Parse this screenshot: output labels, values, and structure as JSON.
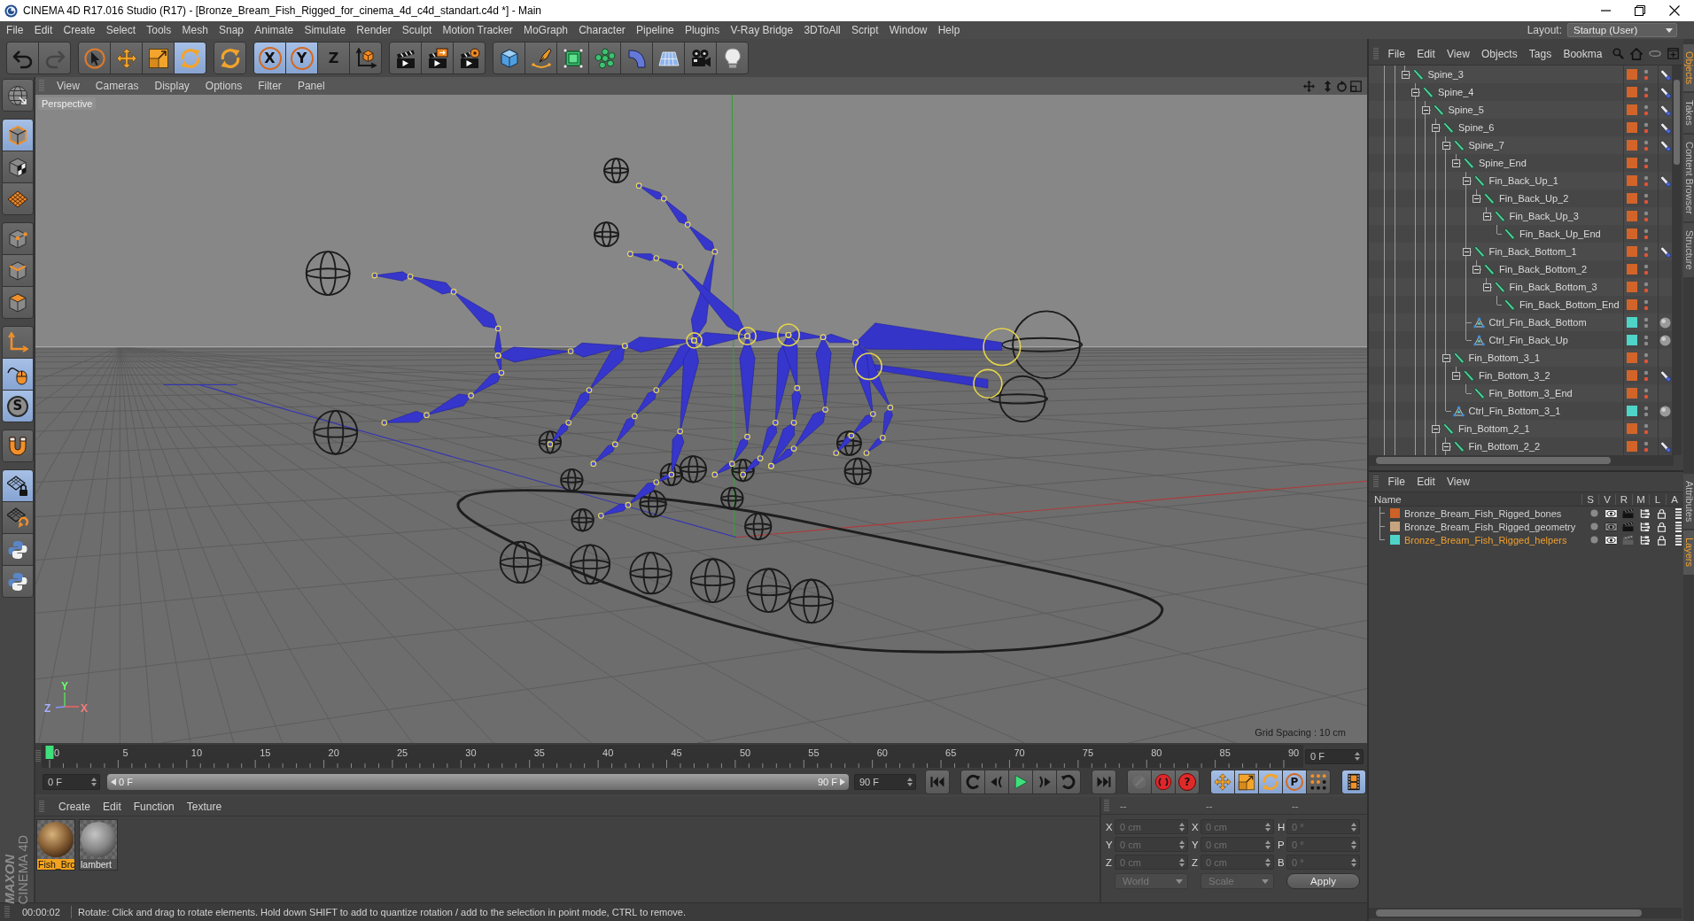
{
  "window": {
    "title": "CINEMA 4D R17.016 Studio (R17) - [Bronze_Bream_Fish_Rigged_for_cinema_4d_c4d_standart.c4d *] - Main"
  },
  "menu_bar": {
    "items": [
      "File",
      "Edit",
      "Create",
      "Select",
      "Tools",
      "Mesh",
      "Snap",
      "Animate",
      "Simulate",
      "Render",
      "Sculpt",
      "Motion Tracker",
      "MoGraph",
      "Character",
      "Pipeline",
      "Plugins",
      "V-Ray Bridge",
      "3DToAll",
      "Script",
      "Window",
      "Help"
    ],
    "layout_label": "Layout:",
    "layout": "Startup (User)"
  },
  "toolbar": {
    "groups": [
      [
        {
          "kind": "undo",
          "disabled": false
        },
        {
          "kind": "redo",
          "disabled": true
        }
      ],
      [
        {
          "kind": "live-select",
          "selected": false
        },
        {
          "kind": "move",
          "selected": false
        },
        {
          "kind": "scale",
          "selected": false
        },
        {
          "kind": "rotate",
          "selected": true
        }
      ],
      [
        {
          "kind": "recent",
          "selected": false
        }
      ],
      [
        {
          "kind": "axis",
          "label": "X",
          "selected": true
        },
        {
          "kind": "axis",
          "label": "Y",
          "selected": true
        },
        {
          "kind": "axis",
          "label": "Z",
          "selected": false
        },
        {
          "kind": "coordinates",
          "selected": false
        }
      ],
      [
        {
          "kind": "render-view"
        },
        {
          "kind": "render-picture"
        },
        {
          "kind": "render-settings"
        }
      ],
      [
        {
          "kind": "cube"
        },
        {
          "kind": "pen"
        },
        {
          "kind": "subdivision"
        },
        {
          "kind": "cloner"
        },
        {
          "kind": "bend"
        },
        {
          "kind": "floor"
        },
        {
          "kind": "camera"
        },
        {
          "kind": "light"
        }
      ]
    ]
  },
  "mode_palette": {
    "groups": [
      [
        {
          "kind": "make-editable",
          "selected": false
        }
      ],
      [
        {
          "kind": "model",
          "selected": true
        },
        {
          "kind": "texture",
          "selected": false
        },
        {
          "kind": "workplane",
          "selected": false
        }
      ],
      [
        {
          "kind": "points",
          "selected": false
        },
        {
          "kind": "edges",
          "selected": false
        },
        {
          "kind": "polygons",
          "selected": false
        }
      ],
      [
        {
          "kind": "axis-mode",
          "selected": false
        },
        {
          "kind": "tweak",
          "selected": true
        },
        {
          "kind": "solo",
          "label": "S",
          "selected": true
        }
      ],
      [
        {
          "kind": "snap",
          "selected": false
        }
      ],
      [
        {
          "kind": "lock-workplane",
          "selected": true
        },
        {
          "kind": "align-workplane",
          "selected": false
        },
        {
          "kind": "python",
          "selected": false
        },
        {
          "kind": "python",
          "selected": false
        }
      ]
    ]
  },
  "logo": {
    "brand": "MAXON",
    "product": "CINEMA 4D"
  },
  "viewport": {
    "menu": [
      "View",
      "Cameras",
      "Display",
      "Options",
      "Filter",
      "Panel"
    ],
    "camera": "Perspective",
    "grid_spacing": "Grid Spacing : 10 cm",
    "gizmo": {
      "y": "Y",
      "z": "Z",
      "x": "X"
    }
  },
  "timeline": {
    "frames": [
      "0",
      "5",
      "10",
      "15",
      "20",
      "25",
      "30",
      "35",
      "40",
      "45",
      "50",
      "55",
      "60",
      "65",
      "70",
      "75",
      "80",
      "85",
      "90"
    ],
    "playhead": {
      "level": 0
    },
    "current": "0 F"
  },
  "transport": {
    "start": "0 F",
    "range": {
      "from": "0 F",
      "to": "90 F",
      "level": 1
    },
    "end": "90 F",
    "groups": [
      [
        {
          "kind": "go-start"
        }
      ],
      [
        {
          "kind": "prev-key"
        },
        {
          "kind": "prev-frame"
        },
        {
          "kind": "play"
        },
        {
          "kind": "next-frame"
        },
        {
          "kind": "next-key"
        }
      ],
      [
        {
          "kind": "go-end"
        }
      ],
      [
        {
          "kind": "autokey",
          "disabled": true
        },
        {
          "kind": "record",
          "disabled": false
        },
        {
          "kind": "key-selection",
          "label": "?",
          "disabled": false
        }
      ],
      [
        {
          "kind": "key-position",
          "selected": true
        },
        {
          "kind": "key-scale",
          "selected": true
        },
        {
          "kind": "key-rotation",
          "selected": true
        },
        {
          "kind": "key-parameter",
          "label": "P",
          "selected": true
        },
        {
          "kind": "key-points",
          "selected": false
        }
      ],
      [
        {
          "kind": "timeline",
          "selected": true
        }
      ]
    ]
  },
  "material_manager": {
    "menu": [
      "Create",
      "Edit",
      "Function",
      "Texture"
    ],
    "items": [
      {
        "name": "Fish_Brc",
        "kind": "textured",
        "selected": true
      },
      {
        "name": "lambert",
        "kind": "plain",
        "selected": false
      }
    ]
  },
  "coordinates": {
    "headers": [
      "--",
      "--",
      "--"
    ],
    "rows": [
      [
        {
          "axis": "X",
          "value": "0 cm",
          "disabled": true
        },
        {
          "axis": "X",
          "value": "0 cm",
          "disabled": true
        },
        {
          "axis": "H",
          "value": "0 °",
          "disabled": true
        }
      ],
      [
        {
          "axis": "Y",
          "value": "0 cm",
          "disabled": true
        },
        {
          "axis": "Y",
          "value": "0 cm",
          "disabled": true
        },
        {
          "axis": "P",
          "value": "0 °",
          "disabled": true
        }
      ],
      [
        {
          "axis": "Z",
          "value": "0 cm",
          "disabled": true
        },
        {
          "axis": "Z",
          "value": "0 cm",
          "disabled": true
        },
        {
          "axis": "B",
          "value": "0 °",
          "disabled": true
        }
      ]
    ],
    "selects": [
      {
        "value": "World",
        "disabled": true
      },
      {
        "value": "Scale",
        "disabled": true
      }
    ],
    "apply": "Apply"
  },
  "status_bar": {
    "time": "00:00:02",
    "message": "Rotate: Click and drag to rotate elements. Hold down SHIFT to add to quantize rotation / add to the selection in point mode, CTRL to remove."
  },
  "object_manager": {
    "menu": [
      "File",
      "Edit",
      "View",
      "Objects",
      "Tags",
      "Bookma"
    ],
    "tree": [
      {
        "name": "Spine_3",
        "kind": "bone",
        "color": "#d2642a",
        "expanded": true,
        "tags": [
          {
            "kind": "ik"
          }
        ],
        "children": [
          {
            "name": "Spine_4",
            "kind": "bone",
            "color": "#d2642a",
            "expanded": true,
            "tags": [
              {
                "kind": "ik"
              }
            ],
            "children": [
              {
                "name": "Spine_5",
                "kind": "bone",
                "color": "#d2642a",
                "expanded": true,
                "tags": [
                  {
                    "kind": "ik"
                  }
                ],
                "children": [
                  {
                    "name": "Spine_6",
                    "kind": "bone",
                    "color": "#d2642a",
                    "expanded": true,
                    "tags": [
                      {
                        "kind": "ik"
                      }
                    ],
                    "children": [
                      {
                        "name": "Spine_7",
                        "kind": "bone",
                        "color": "#d2642a",
                        "expanded": true,
                        "tags": [
                          {
                            "kind": "ik"
                          }
                        ],
                        "children": [
                          {
                            "name": "Spine_End",
                            "kind": "bone",
                            "color": "#d2642a",
                            "expanded": true,
                            "children": [
                              {
                                "name": "Fin_Back_Up_1",
                                "kind": "bone",
                                "color": "#d2642a",
                                "expanded": true,
                                "tags": [
                                  {
                                    "kind": "ik"
                                  }
                                ],
                                "children": [
                                  {
                                    "name": "Fin_Back_Up_2",
                                    "kind": "bone",
                                    "color": "#d2642a",
                                    "expanded": true,
                                    "children": [
                                      {
                                        "name": "Fin_Back_Up_3",
                                        "kind": "bone",
                                        "color": "#d2642a",
                                        "expanded": true,
                                        "children": [
                                          {
                                            "name": "Fin_Back_Up_End",
                                            "kind": "bone",
                                            "color": "#d2642a"
                                          }
                                        ]
                                      }
                                    ]
                                  }
                                ]
                              },
                              {
                                "name": "Fin_Back_Bottom_1",
                                "kind": "bone",
                                "color": "#d2642a",
                                "expanded": true,
                                "tags": [
                                  {
                                    "kind": "ik"
                                  }
                                ],
                                "children": [
                                  {
                                    "name": "Fin_Back_Bottom_2",
                                    "kind": "bone",
                                    "color": "#d2642a",
                                    "expanded": true,
                                    "children": [
                                      {
                                        "name": "Fin_Back_Bottom_3",
                                        "kind": "bone",
                                        "color": "#d2642a",
                                        "expanded": true,
                                        "children": [
                                          {
                                            "name": "Fin_Back_Bottom_End",
                                            "kind": "bone",
                                            "color": "#d2642a"
                                          }
                                        ]
                                      }
                                    ]
                                  }
                                ]
                              },
                              {
                                "name": "Ctrl_Fin_Back_Bottom",
                                "kind": "control",
                                "color": "#4fd4c8",
                                "tags": [
                                  {
                                    "kind": "display"
                                  }
                                ]
                              },
                              {
                                "name": "Ctrl_Fin_Back_Up",
                                "kind": "control",
                                "color": "#4fd4c8",
                                "tags": [
                                  {
                                    "kind": "display"
                                  }
                                ]
                              }
                            ]
                          }
                        ]
                      },
                      {
                        "name": "Fin_Bottom_3_1",
                        "kind": "bone",
                        "color": "#d2642a",
                        "expanded": true,
                        "children": [
                          {
                            "name": "Fin_Bottom_3_2",
                            "kind": "bone",
                            "color": "#d2642a",
                            "expanded": true,
                            "tags": [
                              {
                                "kind": "ik"
                              }
                            ],
                            "children": [
                              {
                                "name": "Fin_Bottom_3_End",
                                "kind": "bone",
                                "color": "#d2642a"
                              }
                            ]
                          }
                        ]
                      },
                      {
                        "name": "Ctrl_Fin_Bottom_3_1",
                        "kind": "control",
                        "color": "#4fd4c8",
                        "tags": [
                          {
                            "kind": "display"
                          }
                        ]
                      }
                    ]
                  },
                  {
                    "name": "Fin_Bottom_2_1",
                    "kind": "bone",
                    "color": "#d2642a",
                    "expanded": true,
                    "children": [
                      {
                        "name": "Fin_Bottom_2_2",
                        "kind": "bone",
                        "color": "#d2642a",
                        "expanded": true,
                        "tags": [
                          {
                            "kind": "ik"
                          }
                        ]
                      }
                    ]
                  }
                ]
              }
            ]
          }
        ]
      }
    ]
  },
  "layer_manager": {
    "menu": [
      "File",
      "Edit",
      "View"
    ],
    "columns": [
      "Name",
      "S",
      "V",
      "R",
      "M",
      "L",
      "A"
    ],
    "layers": [
      {
        "name": "Bronze_Bream_Fish_Rigged_bones",
        "color": "#cc6228",
        "selected": false,
        "visible": true,
        "renderable": true
      },
      {
        "name": "Bronze_Bream_Fish_Rigged_geometry",
        "color": "#c8a47e",
        "selected": false,
        "visible": false,
        "renderable": true
      },
      {
        "name": "Bronze_Bream_Fish_Rigged_helpers",
        "color": "#4fd4c8",
        "selected": true,
        "visible": true,
        "renderable": false
      }
    ]
  },
  "side_tabs": {
    "top": [
      {
        "label": "Objects",
        "selected": true
      },
      {
        "label": "Takes",
        "selected": false
      },
      {
        "label": "Content Browser",
        "selected": false
      },
      {
        "label": "Structure",
        "selected": false
      }
    ],
    "bottom": [
      {
        "label": "Attributes",
        "selected": false
      },
      {
        "label": "Layers",
        "selected": true
      }
    ]
  }
}
